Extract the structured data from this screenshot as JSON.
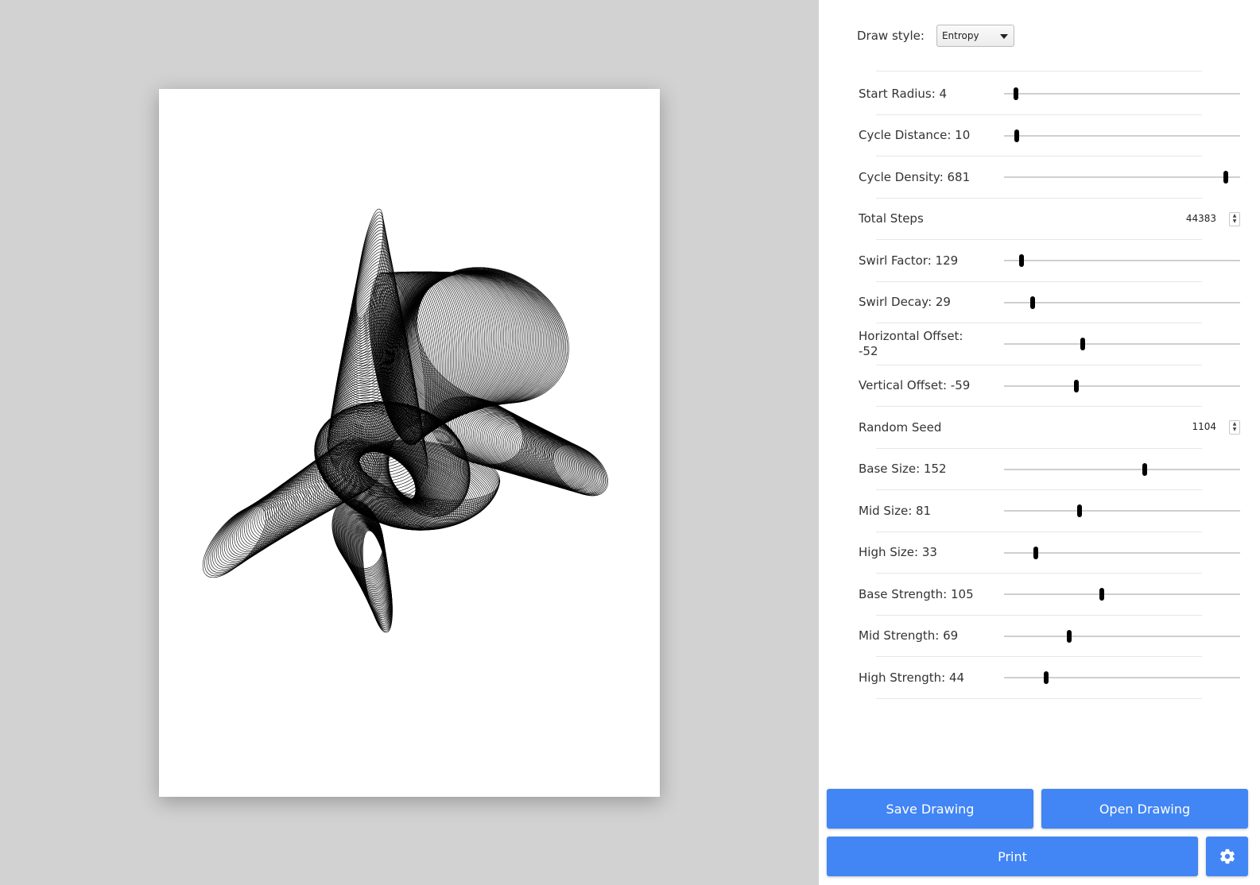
{
  "draw_style": {
    "label": "Draw style:",
    "selected": "Entropy"
  },
  "params": [
    {
      "label": "Start Radius: 4",
      "type": "slider",
      "value": 0.05
    },
    {
      "label": "Cycle Distance: 10",
      "type": "slider",
      "value": 0.055
    },
    {
      "label": "Cycle Density: 681",
      "type": "slider",
      "value": 0.94
    },
    {
      "label": "Total Steps",
      "type": "number",
      "value": "44383"
    },
    {
      "label": "Swirl Factor: 129",
      "type": "slider",
      "value": 0.075
    },
    {
      "label": "Swirl Decay: 29",
      "type": "slider",
      "value": 0.12
    },
    {
      "label": "Horizontal Offset: -52",
      "type": "slider",
      "value": 0.335
    },
    {
      "label": "Vertical Offset: -59",
      "type": "slider",
      "value": 0.305
    },
    {
      "label": "Random Seed",
      "type": "number",
      "value": "1104"
    },
    {
      "label": "Base Size: 152",
      "type": "slider",
      "value": 0.595
    },
    {
      "label": "Mid Size: 81",
      "type": "slider",
      "value": 0.32
    },
    {
      "label": "High Size: 33",
      "type": "slider",
      "value": 0.135
    },
    {
      "label": "Base Strength: 105",
      "type": "slider",
      "value": 0.415
    },
    {
      "label": "Mid Strength: 69",
      "type": "slider",
      "value": 0.275
    },
    {
      "label": "High Strength: 44",
      "type": "slider",
      "value": 0.18
    }
  ],
  "buttons": {
    "save": "Save Drawing",
    "open": "Open Drawing",
    "print": "Print"
  },
  "icons": {
    "settings": "gear-icon"
  },
  "colors": {
    "accent": "#4285f4",
    "stroke": "#000000"
  }
}
